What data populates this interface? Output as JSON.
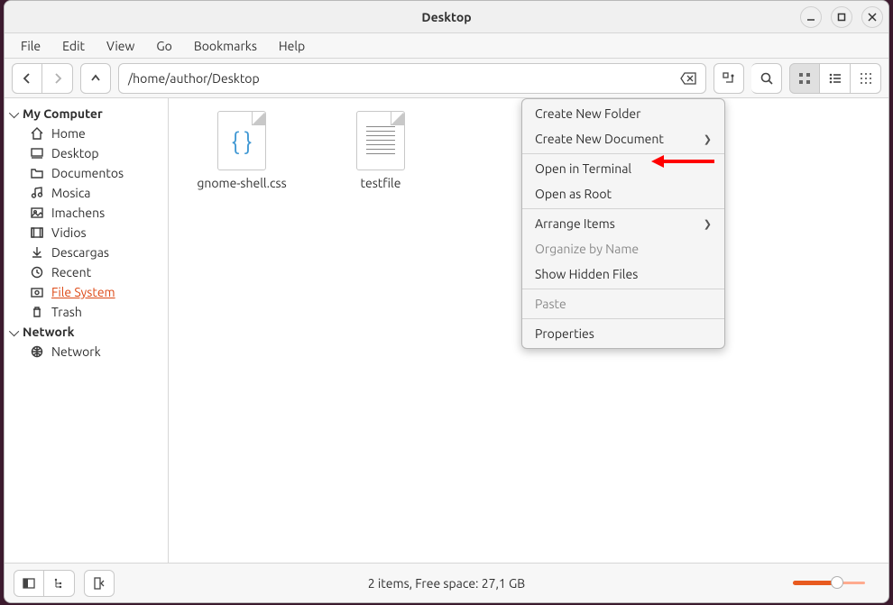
{
  "window": {
    "title": "Desktop"
  },
  "menubar": [
    "File",
    "Edit",
    "View",
    "Go",
    "Bookmarks",
    "Help"
  ],
  "pathbar": {
    "path": "/home/author/Desktop"
  },
  "sidebar": {
    "sections": [
      {
        "title": "My Computer",
        "items": [
          {
            "icon": "home",
            "label": "Home"
          },
          {
            "icon": "desktop",
            "label": "Desktop"
          },
          {
            "icon": "folder",
            "label": "Documentos"
          },
          {
            "icon": "music",
            "label": "Mosica"
          },
          {
            "icon": "pictures",
            "label": "Imachens"
          },
          {
            "icon": "videos",
            "label": "Vidios"
          },
          {
            "icon": "downloads",
            "label": "Descargas"
          },
          {
            "icon": "recent",
            "label": "Recent"
          },
          {
            "icon": "filesystem",
            "label": "File System",
            "active": true
          },
          {
            "icon": "trash",
            "label": "Trash"
          }
        ]
      },
      {
        "title": "Network",
        "items": [
          {
            "icon": "network",
            "label": "Network"
          }
        ]
      }
    ]
  },
  "files": [
    {
      "type": "css",
      "label": "gnome-shell.css"
    },
    {
      "type": "text",
      "label": "testfile"
    }
  ],
  "context_menu": [
    {
      "label": "Create New Folder",
      "type": "item"
    },
    {
      "label": "Create New Document",
      "type": "submenu"
    },
    {
      "type": "sep"
    },
    {
      "label": "Open in Terminal",
      "type": "item",
      "highlighted": true
    },
    {
      "label": "Open as Root",
      "type": "item"
    },
    {
      "type": "sep"
    },
    {
      "label": "Arrange Items",
      "type": "submenu"
    },
    {
      "label": "Organize by Name",
      "type": "item",
      "disabled": true
    },
    {
      "label": "Show Hidden Files",
      "type": "item"
    },
    {
      "type": "sep"
    },
    {
      "label": "Paste",
      "type": "item",
      "disabled": true
    },
    {
      "type": "sep"
    },
    {
      "label": "Properties",
      "type": "item"
    }
  ],
  "statusbar": {
    "text": "2 items, Free space: 27,1 GB"
  },
  "annotation": {
    "color": "#ff0000"
  }
}
